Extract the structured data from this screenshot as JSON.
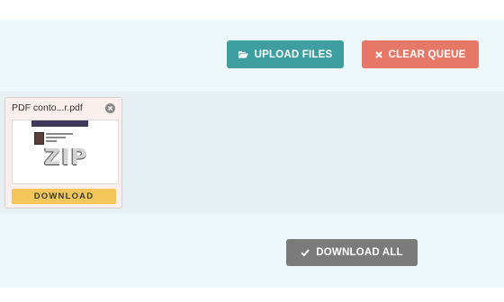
{
  "toolbar": {
    "upload_label": "UPLOAD FILES",
    "clear_label": "CLEAR QUEUE",
    "upload_icon": "folder-open-icon",
    "clear_icon": "times-icon"
  },
  "queue": {
    "items": [
      {
        "file_name": "PDF conto...r.pdf",
        "thumbnail_text": "ZIP",
        "download_label": "DOWNLOAD",
        "close_icon": "close-circle-icon"
      }
    ]
  },
  "footer": {
    "download_all_label": "DOWNLOAD ALL",
    "download_all_icon": "check-icon"
  },
  "colors": {
    "upload": "#3e9ea0",
    "clear": "#e57866",
    "download_all": "#7b7b7b",
    "card_download": "#f4c65a"
  }
}
